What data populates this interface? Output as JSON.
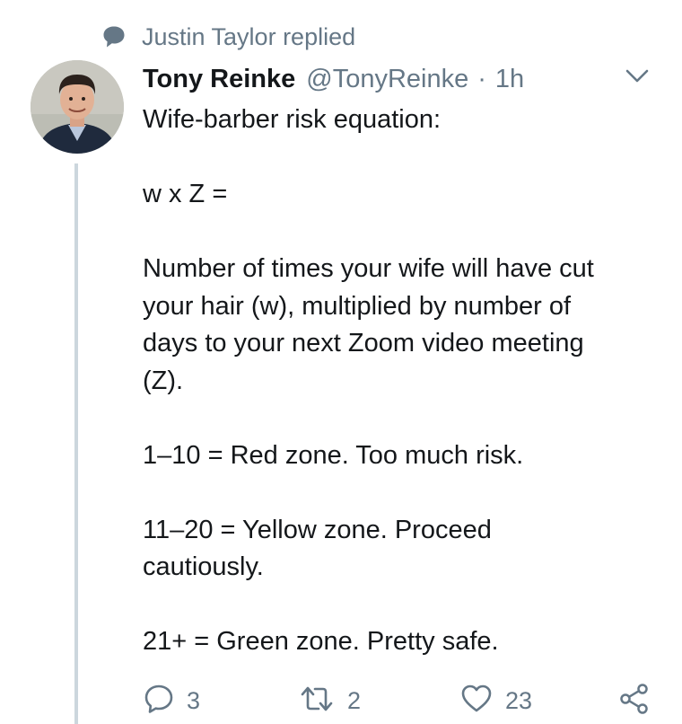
{
  "social_context": {
    "icon": "speech-bubble-icon",
    "text": "Justin Taylor replied"
  },
  "tweet": {
    "author_name": "Tony Reinke",
    "handle": "@TonyReinke",
    "separator": "·",
    "time": "1h",
    "lines": [
      "Wife-barber risk equation:",
      "",
      "w x Z =",
      "",
      "Number of times your wife will have cut",
      "your hair (w), multiplied by number of",
      "days to your next Zoom video meeting",
      "(Z).",
      "",
      "1–10 = Red zone. Too much risk.",
      "",
      "11–20 = Yellow zone. Proceed",
      "cautiously.",
      "",
      "21+ = Green zone. Pretty safe."
    ]
  },
  "actions": {
    "reply_count": "3",
    "retweet_count": "2",
    "like_count": "23"
  },
  "colors": {
    "text": "#14171a",
    "secondary": "#657786",
    "thread_line": "#ccd6dd"
  }
}
